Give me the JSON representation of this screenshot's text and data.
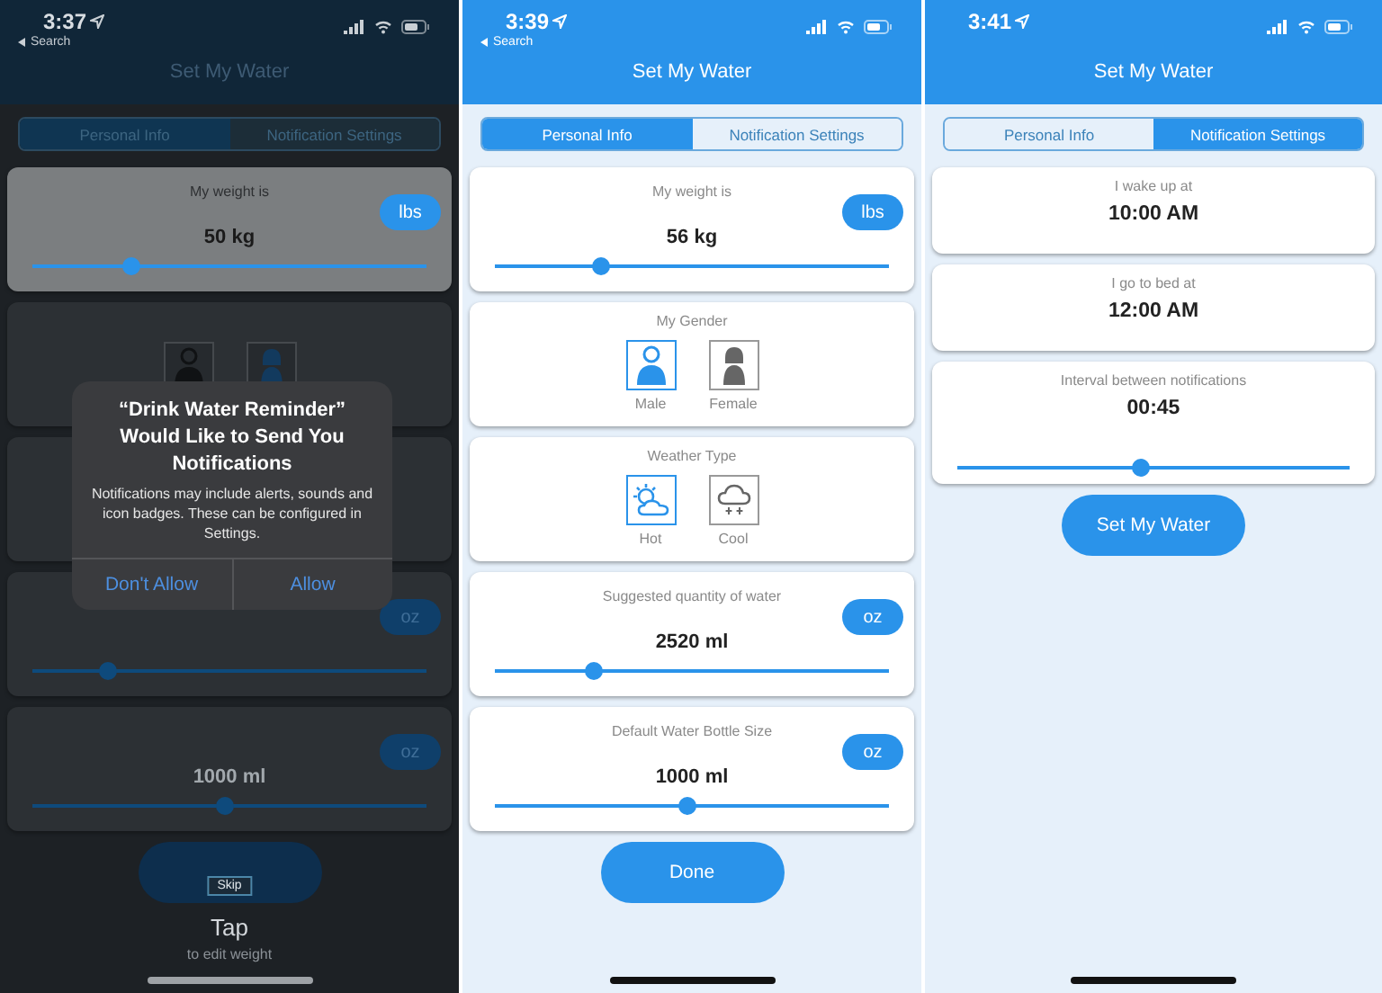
{
  "screens": [
    {
      "dimmed": true,
      "status": {
        "time": "3:37",
        "back": "Search"
      },
      "title": "Set My Water",
      "tabs": [
        {
          "label": "Personal Info",
          "selected": true
        },
        {
          "label": "Notification Settings",
          "selected": false
        }
      ],
      "cards": [
        {
          "kind": "slider",
          "highlighted": true,
          "label": "My weight is",
          "value": "50 kg",
          "unit": "lbs",
          "level": 0.25
        },
        {
          "kind": "choice",
          "highlighted": false,
          "options": [
            {
              "kind": "male",
              "selected": false
            },
            {
              "kind": "female",
              "selected": true
            }
          ]
        },
        {
          "kind": "choice",
          "highlighted": false
        },
        {
          "kind": "slider",
          "highlighted": false,
          "unit": "oz",
          "level": 0.19
        },
        {
          "kind": "slider",
          "highlighted": false,
          "value": "1000 ml",
          "unit": "oz",
          "level": 0.49
        }
      ],
      "coach": {
        "skip": "Skip",
        "title": "Tap",
        "subtitle": "to edit weight"
      },
      "alert": {
        "title": "“Drink Water Reminder” Would Like to Send You Notifications",
        "message": "Notifications may include alerts, sounds and icon badges. These can be configured in Settings.",
        "buttons": [
          "Don't Allow",
          "Allow"
        ]
      }
    },
    {
      "dimmed": false,
      "status": {
        "time": "3:39",
        "back": "Search"
      },
      "title": "Set My Water",
      "tabs": [
        {
          "label": "Personal Info",
          "selected": true
        },
        {
          "label": "Notification Settings",
          "selected": false
        }
      ],
      "cards": [
        {
          "kind": "slider",
          "label": "My weight is",
          "value": "56 kg",
          "unit": "lbs",
          "level": 0.27
        },
        {
          "kind": "choice",
          "label": "My Gender",
          "options": [
            {
              "kind": "male",
              "label": "Male",
              "selected": true
            },
            {
              "kind": "female",
              "label": "Female",
              "selected": false
            }
          ]
        },
        {
          "kind": "choice",
          "label": "Weather Type",
          "options": [
            {
              "kind": "sun",
              "label": "Hot",
              "selected": true
            },
            {
              "kind": "snow",
              "label": "Cool",
              "selected": false
            }
          ]
        },
        {
          "kind": "slider",
          "label": "Suggested quantity of water",
          "value": "2520 ml",
          "unit": "oz",
          "level": 0.25
        },
        {
          "kind": "slider",
          "label": "Default Water Bottle Size",
          "value": "1000 ml",
          "unit": "oz",
          "level": 0.49
        }
      ],
      "button": {
        "label": "Done"
      }
    },
    {
      "dimmed": false,
      "status": {
        "time": "3:41"
      },
      "title": "Set My Water",
      "tabs": [
        {
          "label": "Personal Info",
          "selected": false
        },
        {
          "label": "Notification Settings",
          "selected": true
        }
      ],
      "cards": [
        {
          "kind": "time",
          "label": "I wake up at",
          "value": "10:00 AM"
        },
        {
          "kind": "time",
          "label": "I go to bed at",
          "value": "12:00 AM"
        },
        {
          "kind": "interval",
          "label": "Interval between notifications",
          "value": "00:45",
          "level": 0.47
        }
      ],
      "button": {
        "label": "Set My Water"
      }
    }
  ]
}
